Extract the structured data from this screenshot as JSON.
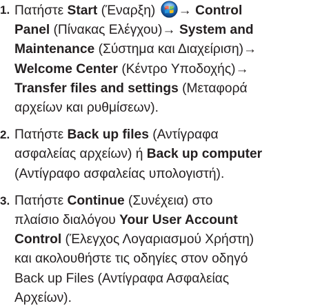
{
  "steps": [
    {
      "number": "1.",
      "lines": [
        [
          "Πατήστε ",
          "Start",
          " (Έναρξη) ",
          "→ ",
          "Control"
        ],
        [
          "Panel",
          " (Πίνακας Ελέγχου)→ ",
          "System and"
        ],
        [
          "Maintenance",
          " (Σύστημα και Διαχείριση)→"
        ],
        [
          "Welcome Center",
          " (Κέντρο Υποδοχής)→"
        ],
        [
          "Transfer files and settings",
          " (Μεταφορά"
        ],
        [
          "αρχείων και ρυθμίσεων)."
        ]
      ],
      "icon": "windows-start-orb-icon"
    },
    {
      "number": "2.",
      "lines": [
        [
          "Πατήστε ",
          "Back up files",
          " (Αντίγραφα"
        ],
        [
          "ασφαλείας αρχείων) ή ",
          "Back up computer"
        ],
        [
          "(Αντίγραφο ασφαλείας υπολογιστή)."
        ]
      ]
    },
    {
      "number": "3.",
      "lines": [
        [
          "Πατήστε ",
          "Continue",
          " (Συνέχεια) στο"
        ],
        [
          "πλαίσιο διαλόγου ",
          "Your User Account"
        ],
        [
          "Control",
          " (Έλεγχος Λογαριασμού Χρήστη)"
        ],
        [
          "και ακολουθήστε τις οδηγίες στον οδηγό"
        ],
        [
          "Back up Files (Αντίγραφα Ασφαλείας"
        ],
        [
          "Αρχείων)."
        ]
      ]
    }
  ],
  "colors": {
    "text": "#231f20",
    "orb_blue": "#1e6fc0",
    "orb_red": "#e8401c",
    "orb_green": "#5cb82e",
    "orb_blue_pane": "#2a9be0",
    "orb_yellow": "#f6c21c"
  }
}
